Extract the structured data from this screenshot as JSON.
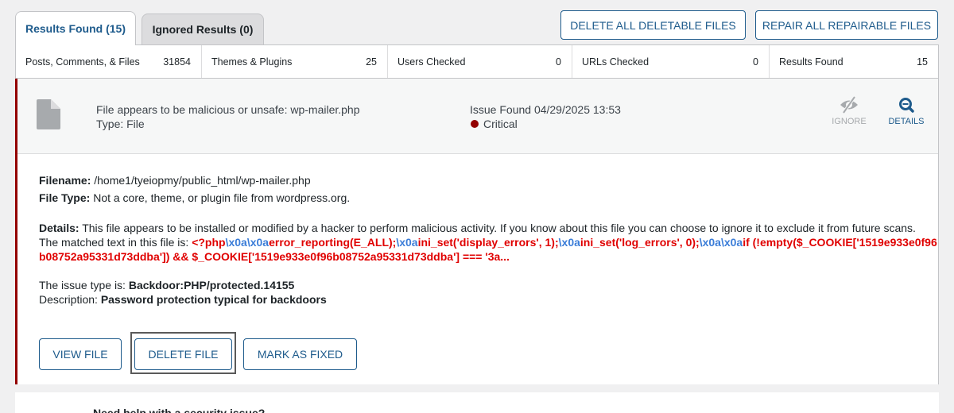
{
  "tabs": [
    {
      "label": "Results Found (15)"
    },
    {
      "label": "Ignored Results (0)"
    }
  ],
  "actions": {
    "delete_all": "DELETE ALL DELETABLE FILES",
    "repair_all": "REPAIR ALL REPAIRABLE FILES"
  },
  "stats": [
    {
      "label": "Posts, Comments, & Files",
      "value": "31854"
    },
    {
      "label": "Themes & Plugins",
      "value": "25"
    },
    {
      "label": "Users Checked",
      "value": "0"
    },
    {
      "label": "URLs Checked",
      "value": "0"
    },
    {
      "label": "Results Found",
      "value": "15"
    }
  ],
  "issue": {
    "title": "File appears to be malicious or unsafe: wp-mailer.php",
    "type": "Type: File",
    "found": "Issue Found 04/29/2025 13:53",
    "severity": "Critical",
    "severity_color": "#930000",
    "ignore_label": "IGNORE",
    "details_label": "DETAILS",
    "filename_label": "Filename:",
    "filename": "/home1/tyeiopmy/public_html/wp-mailer.php",
    "filetype_label": "File Type:",
    "filetype": "Not a core, theme, or plugin file from wordpress.org.",
    "details_label_text": "Details:",
    "details_text": "This file appears to be installed or modified by a hacker to perform malicious activity. If you know about this file you can choose to ignore it to exclude it from future scans.",
    "matched_label": "The matched text in this file is:",
    "matched": [
      {
        "t": "<?php",
        "c": "red"
      },
      {
        "t": "\\x0a\\x0a",
        "c": "blu"
      },
      {
        "t": "error_reporting(E_ALL);",
        "c": "red"
      },
      {
        "t": "\\x0a",
        "c": "blu"
      },
      {
        "t": "ini_set('display_errors', 1);",
        "c": "red"
      },
      {
        "t": "\\x0a",
        "c": "blu"
      },
      {
        "t": "ini_set('log_errors', 0);",
        "c": "red"
      },
      {
        "t": "\\x0a\\x0a",
        "c": "blu"
      },
      {
        "t": "if (!empty($_COOKIE['1519e933e0f96b08752a95331d73ddba']) && $_COOKIE['1519e933e0f96b08752a95331d73ddba'] === '3a...",
        "c": "red"
      }
    ],
    "issue_type_label": "The issue type is:",
    "issue_type": "Backdoor:PHP/protected.14155",
    "description_label": "Description:",
    "description": "Password protection typical for backdoors",
    "view_file": "VIEW FILE",
    "delete_file": "DELETE FILE",
    "mark_fixed": "MARK AS FIXED"
  },
  "footer_text": "Need help with a security issue?",
  "colors": {
    "accent": "#1e5b8c",
    "critical": "#930000",
    "match_red": "#e00000",
    "match_blue": "#3b7dd8"
  },
  "icons": [
    "file-icon",
    "eye-slash-icon",
    "magnify-icon"
  ]
}
